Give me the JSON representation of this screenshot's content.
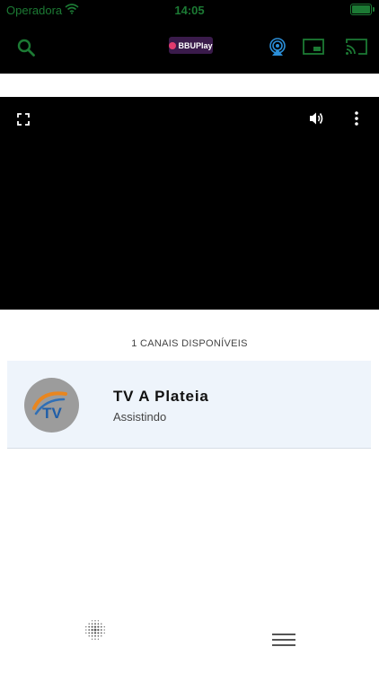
{
  "status_bar": {
    "carrier": "Operadora",
    "time": "14:05",
    "wifi_icon": "wifi-icon",
    "battery_icon": "battery-icon"
  },
  "top_bar": {
    "search_icon": "search-icon",
    "logo_text": "BBUPlay",
    "airplay_icon": "airplay-icon",
    "pip_icon": "picture-in-picture-icon",
    "cast_icon": "cast-icon",
    "accent_color": "#1c7a34",
    "airplay_color": "#2b8fd9"
  },
  "player": {
    "fullscreen_icon": "fullscreen-icon",
    "volume_icon": "volume-icon",
    "more_icon": "more-vertical-icon",
    "background": "#000000"
  },
  "channels": {
    "count_label": "1 CANAIS DISPONÍVEIS",
    "items": [
      {
        "name": "TV A Plateia",
        "status": "Assistindo",
        "logo_text": "TV",
        "highlight_color": "#eef4fb"
      }
    ]
  },
  "bottom_bar": {
    "grid_icon": "dot-grid-icon",
    "menu_icon": "hamburger-menu-icon"
  }
}
